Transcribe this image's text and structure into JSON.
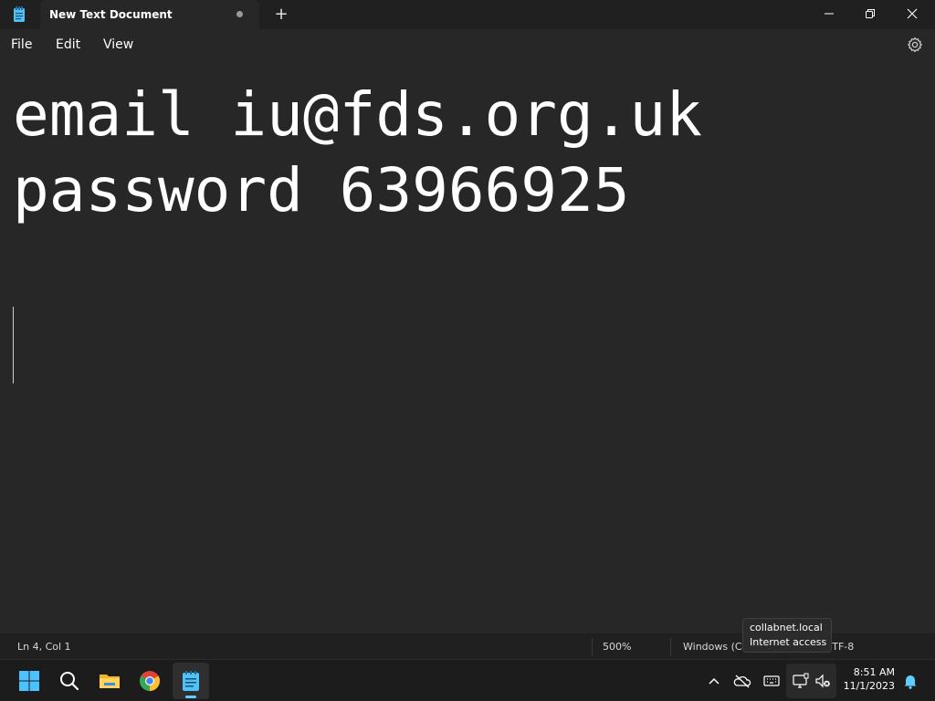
{
  "window": {
    "tab_title": "New Text Document",
    "new_tab_label": "+"
  },
  "menu": {
    "file": "File",
    "edit": "Edit",
    "view": "View"
  },
  "editor": {
    "lines": [
      "email iu@fds.org.uk",
      "password 63966925"
    ]
  },
  "status": {
    "position": "Ln 4, Col 1",
    "zoom": "500%",
    "line_ending": "Windows (C",
    "encoding": "JTF-8"
  },
  "tooltip": {
    "line1": "collabnet.local",
    "line2": "Internet access"
  },
  "clock": {
    "time": "8:51 AM",
    "date": "11/1/2023"
  },
  "colors": {
    "accent": "#60cdff",
    "background": "#272727"
  }
}
